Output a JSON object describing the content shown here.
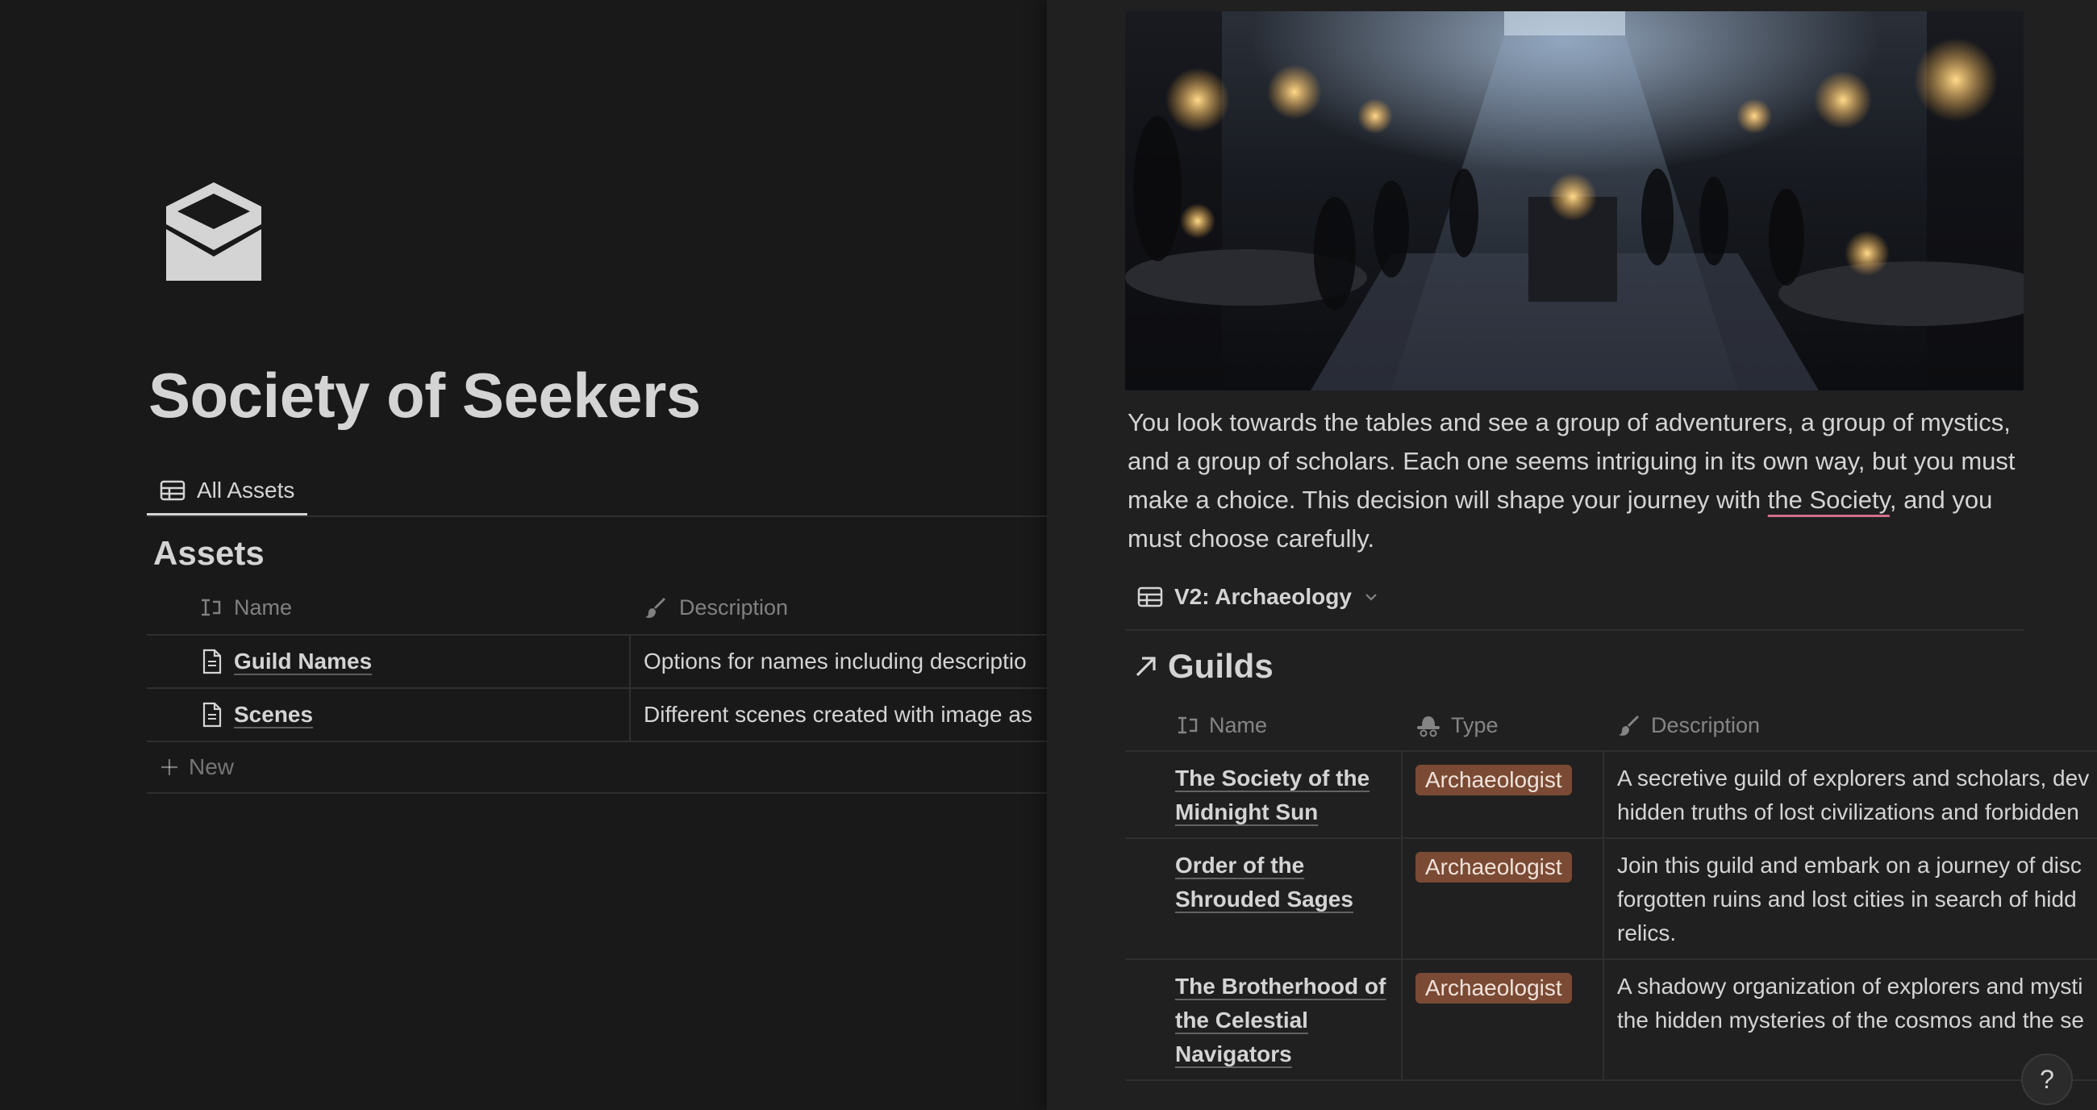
{
  "page": {
    "title": "Society of Seekers",
    "icon": "envelope-open-icon",
    "view_tab": "All Assets",
    "database_title": "Assets"
  },
  "assets_table": {
    "columns": [
      "Name",
      "Description"
    ],
    "rows": [
      {
        "name": "Guild Names",
        "description": "Options for names including descriptio"
      },
      {
        "name": "Scenes",
        "description": "Different scenes created with image as"
      }
    ],
    "new_label": "New"
  },
  "peek": {
    "story_parts": {
      "before": "You look towards the tables and see a group of adventurers, a group of mystics, and a group of scholars. Each one seems intriguing in its own way, but you must make a choice. This decision will shape your journey with ",
      "link": "the Society",
      "after": ", and you must choose carefully."
    },
    "view_name": "V2: Archaeology",
    "linked_db_title": "Guilds",
    "columns": [
      "Name",
      "Type",
      "Description"
    ],
    "rows": [
      {
        "name": "The Society of the Midnight Sun",
        "type": "Archaeologist",
        "description_lines": [
          "A secretive guild of explorers and scholars, dev",
          "hidden truths of lost civilizations and forbidden"
        ]
      },
      {
        "name": "Order of the Shrouded Sages",
        "type": "Archaeologist",
        "description_lines": [
          "Join this guild and embark on a journey of disc",
          "forgotten ruins and lost cities in search of hidd",
          "relics."
        ]
      },
      {
        "name": "The Brotherhood of the Celestial Navigators",
        "type": "Archaeologist",
        "description_lines": [
          "A shadowy organization of explorers and mysti",
          "the hidden mysteries of the cosmos and the se"
        ]
      }
    ],
    "help_label": "?"
  },
  "colors": {
    "background": "#191919",
    "peek_background": "#202020",
    "tag_background": "#7a4a34",
    "link_underline": "#d06f87"
  }
}
